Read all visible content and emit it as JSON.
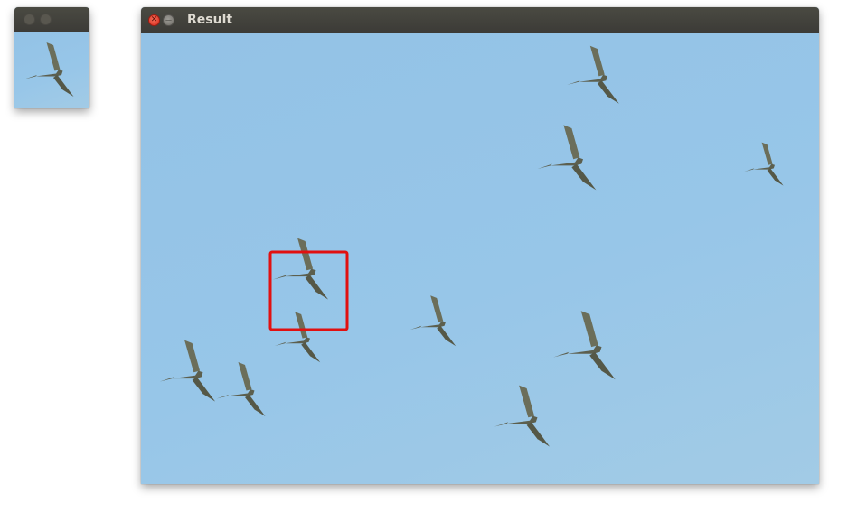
{
  "thumbnail_window": {
    "title": "",
    "buttons": [
      "close-icon",
      "minimize-icon"
    ]
  },
  "result_window": {
    "title": "Result",
    "close_glyph": "✕",
    "minimize_glyph": "—"
  },
  "detection": {
    "color": "#e11010"
  },
  "colors": {
    "sky": "#97c5e6",
    "bird": "#5c5f4e",
    "titlebar": "#3c3b37"
  }
}
